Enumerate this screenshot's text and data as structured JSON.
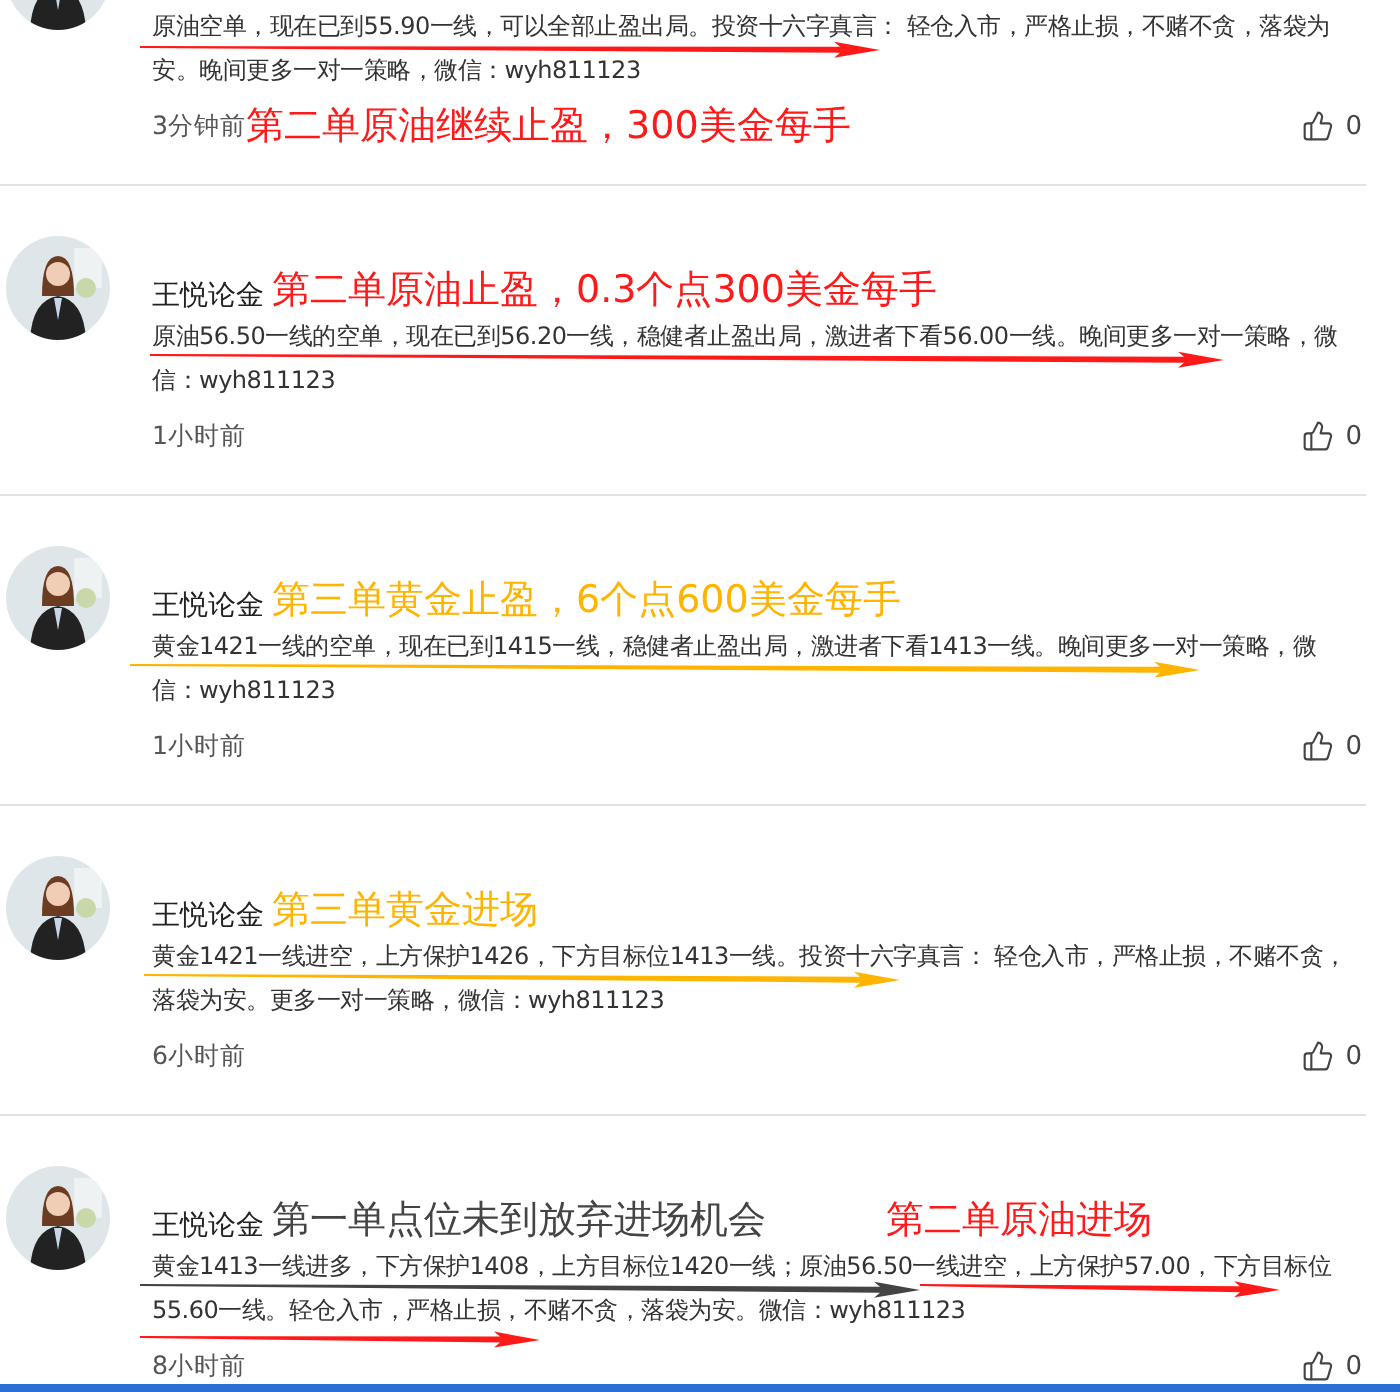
{
  "posts": [
    {
      "annotations": [
        {
          "text": "第二单原油继续止盈，300美金每手",
          "kind": "time",
          "color": "#ff1a1a"
        }
      ],
      "body": "原油空单，现在已到55.90一线，可以全部止盈出局。投资十六字真言： 轻仓入市，严格止损，不赌不贪，落袋为安。晚间更多一对一策略，微信：wyh811123",
      "time": "3分钟前",
      "likes": "0",
      "arrows": [
        {
          "color": "#ff1a1a"
        }
      ]
    },
    {
      "author": "王悦论金",
      "annotations": [
        {
          "text": "第二单原油止盈，0.3个点300美金每手",
          "kind": "name",
          "color": "#ff1a1a"
        }
      ],
      "body": "原油56.50一线的空单，现在已到56.20一线，稳健者止盈出局，激进者下看56.00一线。晚间更多一对一策略，微信：wyh811123",
      "time": "1小时前",
      "likes": "0",
      "arrows": [
        {
          "color": "#ff1a1a"
        }
      ]
    },
    {
      "author": "王悦论金",
      "annotations": [
        {
          "text": "第三单黄金止盈，6个点600美金每手",
          "kind": "name",
          "color": "#ffb400"
        }
      ],
      "body": "黄金1421一线的空单，现在已到1415一线，稳健者止盈出局，激进者下看1413一线。晚间更多一对一策略，微信：wyh811123",
      "time": "1小时前",
      "likes": "0",
      "arrows": [
        {
          "color": "#ffb400"
        }
      ]
    },
    {
      "author": "王悦论金",
      "annotations": [
        {
          "text": "第三单黄金进场",
          "kind": "name",
          "color": "#ffb400"
        }
      ],
      "body": "黄金1421一线进空，上方保护1426，下方目标位1413一线。投资十六字真言： 轻仓入市，严格止损，不赌不贪，落袋为安。更多一对一策略，微信：wyh811123",
      "time": "6小时前",
      "likes": "0",
      "arrows": [
        {
          "color": "#ffb400"
        }
      ]
    },
    {
      "author": "王悦论金",
      "annotations": [
        {
          "text": "第一单点位未到放弃进场机会",
          "kind": "name",
          "color": "#444444"
        },
        {
          "text": "第二单原油进场",
          "kind": "side",
          "color": "#ff1a1a"
        }
      ],
      "body": "黄金1413一线进多，下方保护1408，上方目标位1420一线；原油56.50一线进空，上方保护57.00，下方目标位55.60一线。轻仓入市，严格止损，不赌不贪，落袋为安。微信：wyh811123",
      "time": "8小时前",
      "likes": "0",
      "arrows": [
        {
          "color": "#444444"
        },
        {
          "color": "#ff1a1a"
        },
        {
          "color": "#ff1a1a"
        }
      ]
    }
  ]
}
